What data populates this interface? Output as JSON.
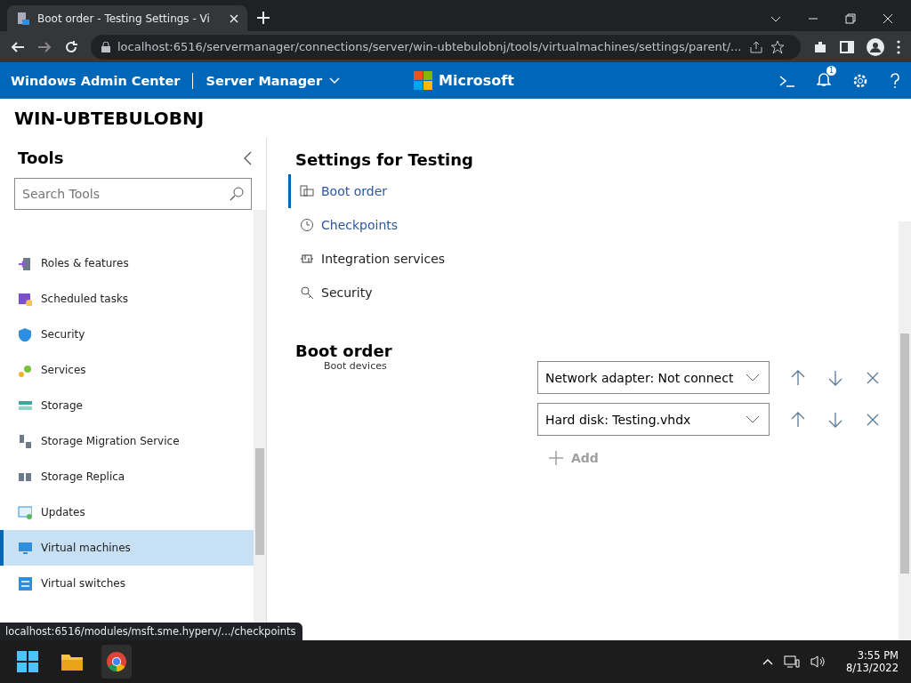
{
  "browser": {
    "tab_title": "Boot order - Testing Settings - Vi",
    "address": "localhost:6516/servermanager/connections/server/win-ubtebulobnj/tools/virtualmachines/settings/parent/..."
  },
  "app_header": {
    "product": "Windows Admin Center",
    "context": "Server Manager",
    "brand": "Microsoft",
    "notification_count": "1"
  },
  "server_name": "WIN-UBTEBULOBNJ",
  "tools": {
    "title": "Tools",
    "search": {
      "placeholder": "Search Tools"
    },
    "items": [
      {
        "label": "Roles & features",
        "selected": false
      },
      {
        "label": "Scheduled tasks",
        "selected": false
      },
      {
        "label": "Security",
        "selected": false
      },
      {
        "label": "Services",
        "selected": false
      },
      {
        "label": "Storage",
        "selected": false
      },
      {
        "label": "Storage Migration Service",
        "selected": false
      },
      {
        "label": "Storage Replica",
        "selected": false
      },
      {
        "label": "Updates",
        "selected": false
      },
      {
        "label": "Virtual machines",
        "selected": true
      },
      {
        "label": "Virtual switches",
        "selected": false
      }
    ]
  },
  "settings": {
    "title": "Settings for Testing",
    "nav": [
      {
        "label": "Boot order",
        "selected": true,
        "hovered": false
      },
      {
        "label": "Checkpoints",
        "selected": false,
        "hovered": true
      },
      {
        "label": "Integration services",
        "selected": false,
        "hovered": false
      },
      {
        "label": "Security",
        "selected": false,
        "hovered": false
      }
    ],
    "section_title": "Boot order",
    "field_label": "Boot devices",
    "devices": [
      {
        "value": "Network adapter: Not connect"
      },
      {
        "value": "Hard disk: Testing.vhdx"
      }
    ],
    "add_label": "Add"
  },
  "status_url": "localhost:6516/modules/msft.sme.hyperv/.../checkpoints",
  "taskbar": {
    "time": "3:55 PM",
    "date": "8/13/2022"
  }
}
